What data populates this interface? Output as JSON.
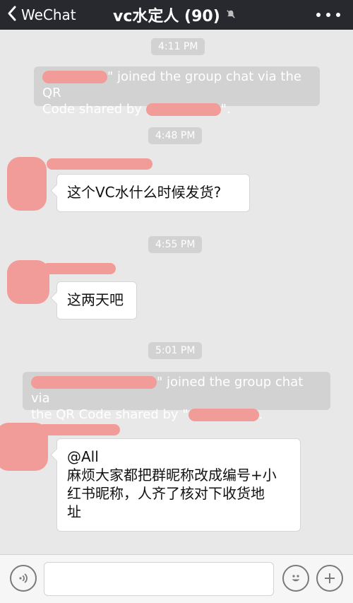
{
  "header": {
    "back_label": "WeChat",
    "title": "vc水定人 (90)",
    "back_icon": "chevron-left-icon",
    "mute_icon": "bell-muted-icon",
    "more_icon": "more-dots-icon"
  },
  "chat": {
    "timestamps": [
      "4:11 PM",
      "4:48 PM",
      "4:55 PM",
      "5:01 PM"
    ],
    "system_messages": [
      {
        "part1": "\" joined the group chat via the QR",
        "part2": "Code shared by",
        "part3": "\"."
      },
      {
        "part1": "\" joined the group chat via",
        "part2": "the QR Code shared by \"",
        "part3": "."
      }
    ],
    "messages": [
      {
        "text": "这个VC水什么时候发货?"
      },
      {
        "text": "这两天吧"
      },
      {
        "text": "@All\n麻烦大家都把群昵称改成编号+小\n红书昵称，人齐了核对下收货地\n址"
      }
    ]
  },
  "bottom": {
    "voice_icon": "voice-icon",
    "emoji_icon": "emoji-icon",
    "plus_icon": "plus-icon",
    "input_value": ""
  },
  "colors": {
    "topbar": "#27292e",
    "chat_bg": "#e8e8e8",
    "system_pill": "#d2d2d2",
    "redaction": "#f19c98"
  }
}
